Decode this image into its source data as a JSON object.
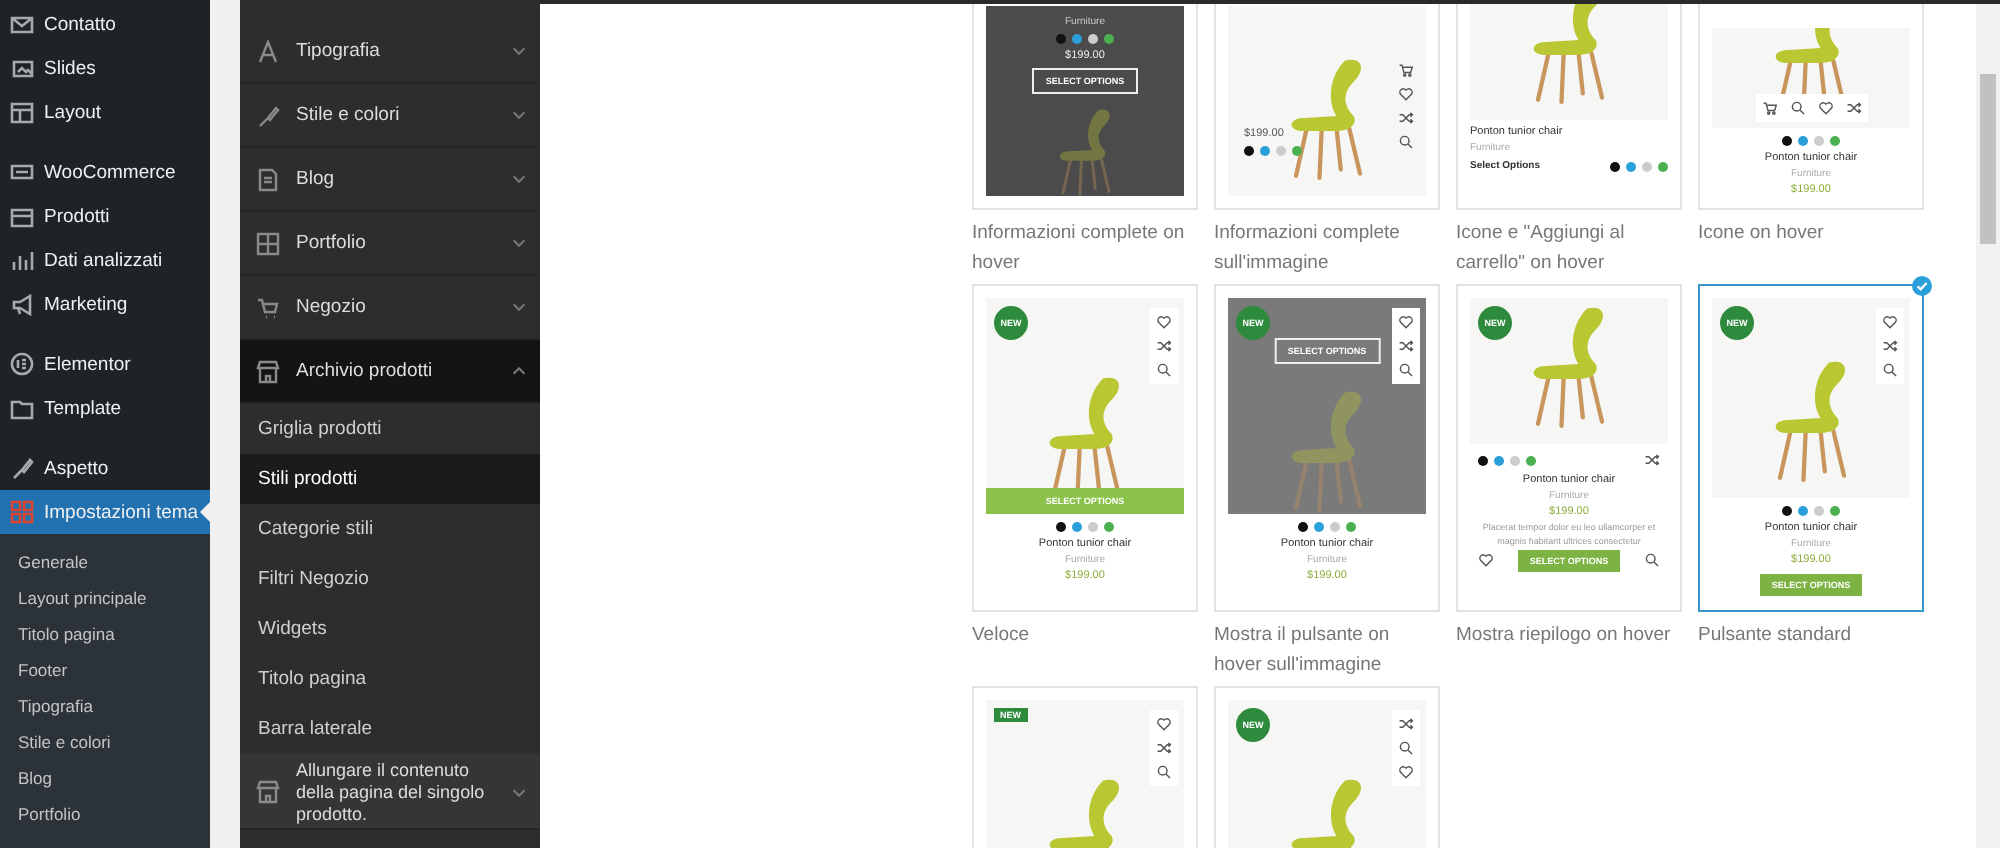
{
  "admin_menu": {
    "groups": [
      {
        "items": [
          {
            "label": "Contatto",
            "selected": false
          },
          {
            "label": "Slides",
            "selected": false
          },
          {
            "label": "Layout",
            "selected": false
          }
        ]
      },
      {
        "items": [
          {
            "label": "WooCommerce",
            "selected": false
          },
          {
            "label": "Prodotti",
            "selected": false
          },
          {
            "label": "Dati analizzati",
            "selected": false
          },
          {
            "label": "Marketing",
            "selected": false
          }
        ]
      },
      {
        "items": [
          {
            "label": "Elementor",
            "selected": false
          },
          {
            "label": "Template",
            "selected": false
          }
        ]
      },
      {
        "items": [
          {
            "label": "Aspetto",
            "selected": false
          },
          {
            "label": "Impostazioni tema",
            "selected": true,
            "children": [
              {
                "label": "Generale"
              },
              {
                "label": "Layout principale"
              },
              {
                "label": "Titolo pagina"
              },
              {
                "label": "Footer"
              },
              {
                "label": "Tipografia"
              },
              {
                "label": "Stile e colori"
              },
              {
                "label": "Blog"
              },
              {
                "label": "Portfolio"
              }
            ]
          }
        ]
      }
    ]
  },
  "customizer": {
    "sections": [
      {
        "label": "Tipografia",
        "expanded": false
      },
      {
        "label": "Stile e colori",
        "expanded": false
      },
      {
        "label": "Blog",
        "expanded": false
      },
      {
        "label": "Portfolio",
        "expanded": false
      },
      {
        "label": "Negozio",
        "expanded": false
      },
      {
        "label": "Archivio prodotti",
        "expanded": true,
        "children": [
          {
            "label": "Griglia prodotti",
            "selected": false
          },
          {
            "label": "Stili prodotti",
            "selected": true
          },
          {
            "label": "Categorie stili",
            "selected": false
          },
          {
            "label": "Filtri Negozio",
            "selected": false
          },
          {
            "label": "Widgets",
            "selected": false
          },
          {
            "label": "Titolo pagina",
            "selected": false
          },
          {
            "label": "Barra laterale",
            "selected": false
          }
        ]
      },
      {
        "label": "Allungare il contenuto della pagina del singolo prodotto.",
        "expanded": false
      }
    ]
  },
  "product_styles": {
    "rows": [
      {
        "cards": [
          {
            "kind": "dark-hover",
            "selected": false,
            "category": "Furniture",
            "swatches": [
              {
                "color": "#111111"
              },
              {
                "color": "#2b9fd9"
              },
              {
                "color": "#cccccc"
              },
              {
                "color": "#4caf50"
              }
            ],
            "price": "$199.00",
            "button": "SELECT OPTIONS",
            "caption": "Informazioni complete on hover"
          },
          {
            "kind": "image-info",
            "selected": false,
            "price": "$199.00",
            "swatches": [
              {
                "color": "#111111"
              },
              {
                "color": "#2b9fd9"
              },
              {
                "color": "#cccccc"
              },
              {
                "color": "#4caf50"
              }
            ],
            "caption": "Informazioni complete sull'immagine"
          },
          {
            "kind": "icons-cart",
            "selected": false,
            "name": "Ponton tunior chair",
            "category": "Furniture",
            "button": "Select Options",
            "swatches": [
              {
                "color": "#111111"
              },
              {
                "color": "#2b9fd9"
              },
              {
                "color": "#cccccc"
              },
              {
                "color": "#4caf50"
              }
            ],
            "caption": "Icone e \"Aggiungi al carrello\" on hover"
          },
          {
            "kind": "icons-hover",
            "selected": false,
            "swatches": [
              {
                "color": "#111111"
              },
              {
                "color": "#2b9fd9"
              },
              {
                "color": "#cccccc"
              },
              {
                "color": "#4caf50"
              }
            ],
            "name": "Ponton tunior chair",
            "category": "Furniture",
            "price": "$199.00",
            "caption": "Icone on hover"
          }
        ]
      },
      {
        "cards": [
          {
            "kind": "quick",
            "selected": false,
            "badge": {
              "text": "NEW",
              "kind": "round"
            },
            "button": "SELECT OPTIONS",
            "swatches": [
              {
                "color": "#111111"
              },
              {
                "color": "#2b9fd9"
              },
              {
                "color": "#cccccc"
              },
              {
                "color": "#4caf50"
              }
            ],
            "name": "Ponton tunior chair",
            "category": "Furniture",
            "price": "$199.00",
            "caption": "Veloce"
          },
          {
            "kind": "hover-button",
            "selected": false,
            "badge": {
              "text": "NEW",
              "kind": "round"
            },
            "button": "SELECT OPTIONS",
            "swatches": [
              {
                "color": "#111111"
              },
              {
                "color": "#2b9fd9"
              },
              {
                "color": "#cccccc"
              },
              {
                "color": "#4caf50"
              }
            ],
            "name": "Ponton tunior chair",
            "category": "Furniture",
            "price": "$199.00",
            "caption": "Mostra il pulsante on hover sull'immagine"
          },
          {
            "kind": "summary",
            "selected": false,
            "badge": {
              "text": "NEW",
              "kind": "round"
            },
            "swatches": [
              {
                "color": "#111111"
              },
              {
                "color": "#2b9fd9"
              },
              {
                "color": "#cccccc"
              },
              {
                "color": "#4caf50"
              }
            ],
            "name": "Ponton tunior chair",
            "category": "Furniture",
            "price": "$199.00",
            "description": "Placerat tempor dolor eu leo ullamcorper et magnis habitant ultrices consectetur",
            "button": "SELECT OPTIONS",
            "caption": "Mostra riepilogo on hover"
          },
          {
            "kind": "standard",
            "selected": true,
            "badge": {
              "text": "NEW",
              "kind": "round"
            },
            "swatches": [
              {
                "color": "#111111"
              },
              {
                "color": "#2b9fd9"
              },
              {
                "color": "#cccccc"
              },
              {
                "color": "#4caf50"
              }
            ],
            "name": "Ponton tunior chair",
            "category": "Furniture",
            "price": "$199.00",
            "button": "SELECT OPTIONS",
            "caption": "Pulsante standard"
          }
        ]
      },
      {
        "cards": [
          {
            "kind": "plain",
            "selected": false,
            "badge": {
              "text": "NEW",
              "kind": "square"
            }
          },
          {
            "kind": "plain-alt",
            "selected": false,
            "badge": {
              "text": "NEW",
              "kind": "round"
            }
          }
        ]
      }
    ]
  }
}
